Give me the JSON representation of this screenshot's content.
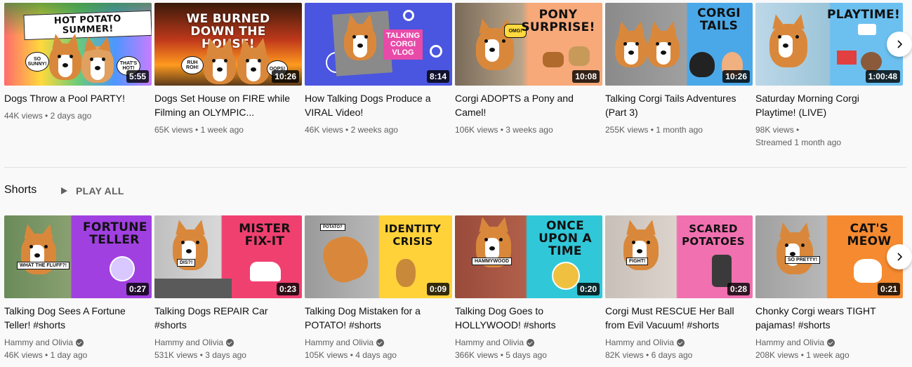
{
  "top_row": [
    {
      "title": "Dogs Throw a Pool PARTY!",
      "views": "44K views",
      "age": "2 days ago",
      "duration": "5:55",
      "thumb_text": "HOT POTATO SUMMER!",
      "bubbles": [
        "SO SUNNY!",
        "THAT'S HOT!"
      ]
    },
    {
      "title": "Dogs Set House on FIRE while Filming an OLYMPIC...",
      "views": "65K views",
      "age": "1 week ago",
      "duration": "10:26",
      "thumb_text": "WE BURNED DOWN THE HOUSE!",
      "bubbles": [
        "RUH ROH!",
        "OOPS!"
      ]
    },
    {
      "title": "How Talking Dogs Produce a VIRAL Video!",
      "views": "46K views",
      "age": "2 weeks ago",
      "duration": "8:14",
      "thumb_text": "TALKING CORGI VLOG",
      "bubbles": []
    },
    {
      "title": "Corgi ADOPTS a Pony and Camel!",
      "views": "106K views",
      "age": "3 weeks ago",
      "duration": "10:08",
      "thumb_text": "PONY SURPRISE!",
      "bubbles": [
        "OMG!"
      ]
    },
    {
      "title": "Talking Corgi Tails Adventures (Part 3)",
      "views": "255K views",
      "age": "1 month ago",
      "duration": "10:26",
      "thumb_text": "CORGI TAILS",
      "bubbles": []
    },
    {
      "title": "Saturday Morning Corgi Playtime! (LIVE)",
      "views": "98K views •",
      "age": "Streamed 1 month ago",
      "duration": "1:00:48",
      "thumb_text": "PLAYTIME!",
      "bubbles": []
    }
  ],
  "shelf": {
    "title": "Shorts",
    "play_all": "PLAY ALL"
  },
  "shorts": [
    {
      "title": "Talking Dog Sees A Fortune Teller! #shorts",
      "channel": "Hammy and Olivia",
      "views": "46K views",
      "age": "1 day ago",
      "duration": "0:27",
      "thumb_text": "FORTUNE TELLER",
      "tag": "WHAT THE FLUFF?!"
    },
    {
      "title": "Talking Dogs REPAIR Car #shorts",
      "channel": "Hammy and Olivia",
      "views": "531K views",
      "age": "3 days ago",
      "duration": "0:23",
      "thumb_text": "MISTER FIX-IT",
      "tag": "DIS?!"
    },
    {
      "title": "Talking Dog Mistaken for a POTATO! #shorts",
      "channel": "Hammy and Olivia",
      "views": "105K views",
      "age": "4 days ago",
      "duration": "0:09",
      "thumb_text": "IDENTITY CRISIS",
      "tag": "POTATO?"
    },
    {
      "title": "Talking Dog Goes to HOLLYWOOD! #shorts",
      "channel": "Hammy and Olivia",
      "views": "366K views",
      "age": "5 days ago",
      "duration": "0:20",
      "thumb_text": "ONCE UPON A TIME",
      "tag": "HAMMYWOOD"
    },
    {
      "title": "Corgi Must RESCUE Her Ball from Evil Vacuum! #shorts",
      "channel": "Hammy and Olivia",
      "views": "82K views",
      "age": "6 days ago",
      "duration": "0:28",
      "thumb_text": "SCARED POTATOES",
      "tag": "FIGHT!"
    },
    {
      "title": "Chonky Corgi wears TIGHT pajamas! #shorts",
      "channel": "Hammy and Olivia",
      "views": "208K views",
      "age": "1 week ago",
      "duration": "0:21",
      "thumb_text": "CAT'S MEOW",
      "tag": "SO PRETTY!"
    }
  ],
  "colors": {
    "background": "#f9f9f9",
    "meta_text": "#606060",
    "title_text": "#0f0f0f",
    "duration_bg": "#000000cc"
  },
  "icons": {
    "next": "chevron-right-icon",
    "play": "play-icon",
    "verified": "verified-check-icon"
  }
}
